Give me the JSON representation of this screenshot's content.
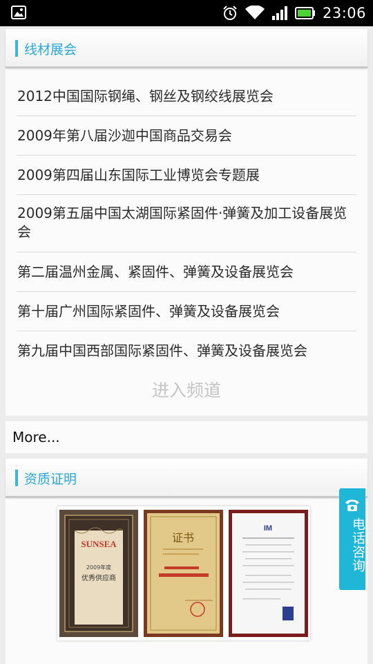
{
  "status_bar": {
    "time": "23:06",
    "icons": [
      "image-notification-icon",
      "alarm-icon",
      "wifi-icon",
      "cell-signal-icon",
      "battery-icon"
    ]
  },
  "exhibitions": {
    "title": "线材展会",
    "items": [
      "2012中国国际钢绳、钢丝及钢绞线展览会",
      "2009年第八届沙迦中国商品交易会",
      "2009第四届山东国际工业博览会专题展",
      "2009第五届中国太湖国际紧固件·弹簧及加工设备展览会",
      "第二届温州金属、紧固件、弹簧及设备展览会",
      "第十届广州国际紧固件、弹簧及设备展览会",
      "第九届中国西部国际紧固件、弹簧及设备展览会"
    ],
    "enter_channel": "进入频道"
  },
  "more_link": "More...",
  "qualification": {
    "title": "资质证明",
    "certificates": [
      {
        "brand": "SUNSEA",
        "line1": "2009年度",
        "line2": "优秀供应商"
      },
      {
        "heading": "证书"
      },
      {
        "logo": "IM"
      }
    ]
  },
  "float_button": {
    "label": "电话咨询",
    "icon": "phone-icon"
  },
  "colors": {
    "accent": "#2aa8d6",
    "status_bar": "#000000",
    "float_button": "#20b6d8"
  }
}
